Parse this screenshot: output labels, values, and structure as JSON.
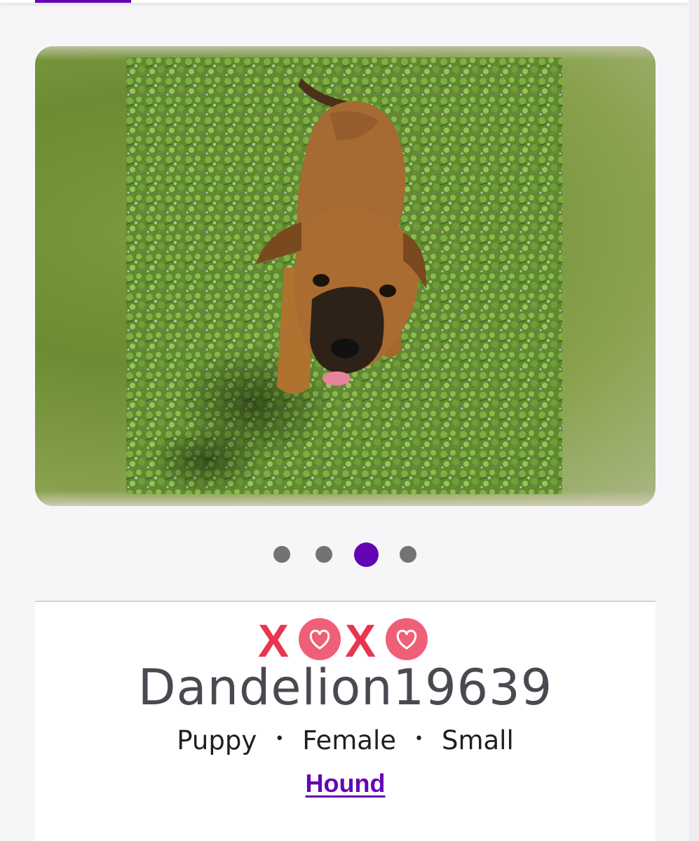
{
  "colors": {
    "brand_purple": "#6504b5",
    "dot_inactive": "#737373",
    "xoxo_red": "#e8364f",
    "xoxo_pink": "#ef5f78"
  },
  "carousel": {
    "slide_count": 4,
    "active_index": 2,
    "photo_label": "puppy-photo"
  },
  "badge": {
    "icon": "xoxo-hearts-icon",
    "letters": [
      "X",
      "X"
    ]
  },
  "pet": {
    "name": "Dandelion19639",
    "age": "Puppy",
    "sex": "Female",
    "size": "Small",
    "separator": "•",
    "breed": "Hound"
  }
}
